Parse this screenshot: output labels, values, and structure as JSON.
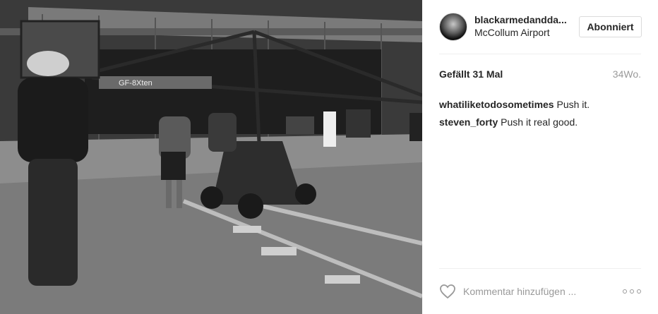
{
  "post": {
    "image_alt": "Schwarz-Weiß-Foto einer Kamerakran-Crew auf dem Vorfeld vor einem Hangar",
    "crane_label": "GF-8Xten"
  },
  "header": {
    "username": "blackarmedandda...",
    "location": "McCollum Airport",
    "follow_label": "Abonniert"
  },
  "stats": {
    "likes": "Gefällt 31 Mal",
    "time": "34Wo."
  },
  "comments": [
    {
      "user": "whatiliketodosometimes",
      "text": "Push it."
    },
    {
      "user": "steven_forty",
      "text": "Push it real good."
    }
  ],
  "footer": {
    "comment_placeholder": "Kommentar hinzufügen ..."
  },
  "colors": {
    "border": "#dbdbdb",
    "divider": "#efefef",
    "muted": "#999999",
    "text": "#262626"
  }
}
